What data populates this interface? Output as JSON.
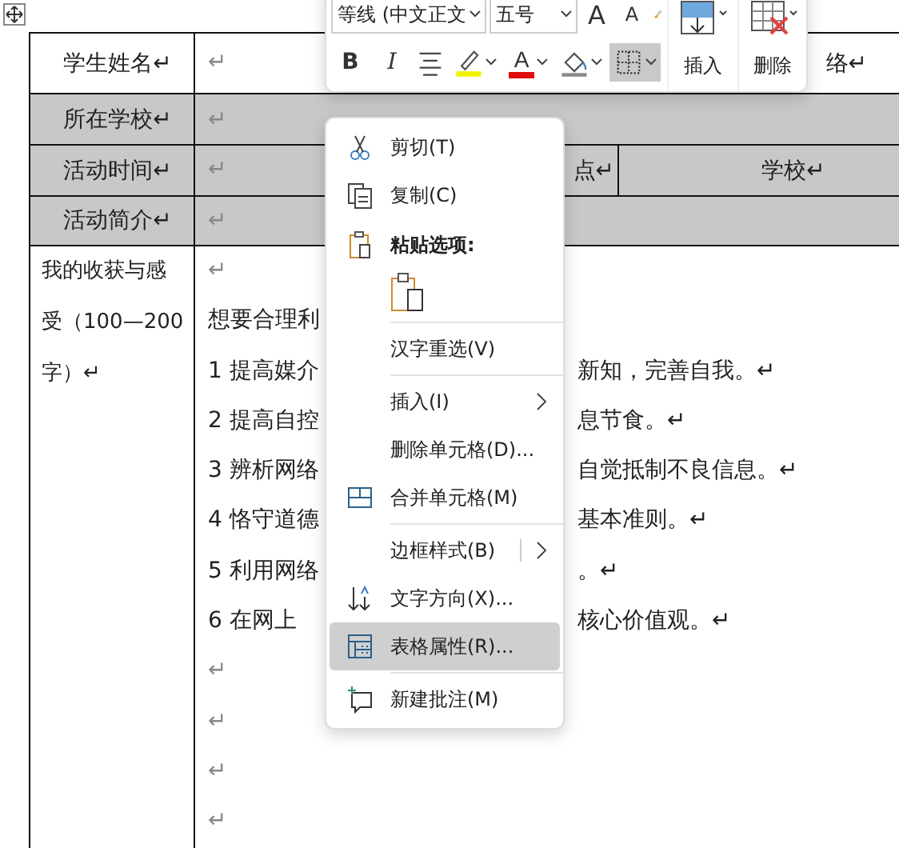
{
  "table": {
    "rows": [
      {
        "kind": "name",
        "label": "学生姓名↵",
        "shaded": false,
        "cells": [
          "↵",
          "络↵"
        ]
      },
      {
        "kind": "plain",
        "label": "所在学校↵",
        "shaded": true,
        "cells": [
          "↵"
        ]
      },
      {
        "kind": "split",
        "label": "活动时间↵",
        "shaded": true,
        "cells": [
          "↵",
          "点↵",
          "学校↵"
        ]
      },
      {
        "kind": "plain",
        "label": "活动简介↵",
        "shaded": true,
        "cells": [
          "↵"
        ]
      },
      {
        "kind": "body",
        "label": "我的收获与感受（100—200字）↵",
        "shaded": false,
        "lines": [
          {
            "left": "↵"
          },
          {
            "left": "想要合理利"
          },
          {
            "left": "1  提高媒介",
            "right": "新知，完善自我。↵"
          },
          {
            "left": "2  提高自控",
            "right": "息节食。↵"
          },
          {
            "left": "3  辨析网络",
            "right": "自觉抵制不良信息。↵"
          },
          {
            "left": "4  恪守道德",
            "right": "基本准则。↵"
          },
          {
            "left": "5  利用网络",
            "right": "。↵"
          },
          {
            "left": "6  在网上",
            "right": "核心价值观。↵"
          },
          {
            "left": "↵"
          },
          {
            "left": "↵"
          },
          {
            "left": "↵"
          },
          {
            "left": "↵"
          }
        ]
      }
    ]
  },
  "mini_toolbar": {
    "font": "等线 (中文正文",
    "size": "五号",
    "grow_font": "A",
    "shrink_font": "A",
    "bold": "B",
    "italic": "I",
    "font_color": "A",
    "borders_selected": true,
    "buttons": [
      {
        "kind": "insert",
        "label": "插入"
      },
      {
        "kind": "delete",
        "label": "删除"
      }
    ]
  },
  "context_menu": {
    "items": [
      {
        "kind": "cut",
        "label": "剪切(T)",
        "selected": false
      },
      {
        "kind": "copy",
        "label": "复制(C)",
        "selected": false
      },
      {
        "kind": "heading",
        "label": "粘贴选项:"
      },
      {
        "kind": "paste"
      },
      {
        "kind": "separator"
      },
      {
        "kind": "item",
        "label": "汉字重选(V)",
        "selected": false
      },
      {
        "kind": "separator"
      },
      {
        "kind": "submenu",
        "label": "插入(I)",
        "selected": false
      },
      {
        "kind": "item",
        "label": "删除单元格(D)...",
        "selected": false
      },
      {
        "kind": "merge",
        "label": "合并单元格(M)",
        "selected": false
      },
      {
        "kind": "separator"
      },
      {
        "kind": "submenu",
        "label": "边框样式(B)",
        "split": true,
        "selected": false
      },
      {
        "kind": "direction",
        "label": "文字方向(X)...",
        "selected": false
      },
      {
        "kind": "properties",
        "label": "表格属性(R)...",
        "selected": true
      },
      {
        "kind": "separator"
      },
      {
        "kind": "comment",
        "label": "新建批注(M)",
        "selected": false
      }
    ]
  }
}
